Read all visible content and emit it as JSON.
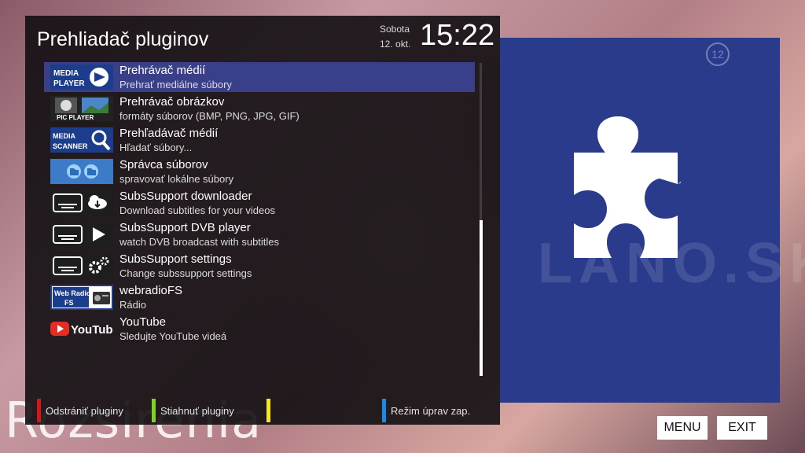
{
  "background": {
    "caption": "Rozsirenia",
    "watermark": "LANO.SK"
  },
  "header": {
    "title": "Prehliadač pluginov",
    "day": "Sobota",
    "date": "12. okt.",
    "time": "15:22"
  },
  "plugins": [
    {
      "title": "Prehrávač médií",
      "subtitle": "Prehrať mediálne súbory",
      "icon": "media-player-icon",
      "icon_text": "MEDIA PLAYER"
    },
    {
      "title": "Prehrávač obrázkov",
      "subtitle": "formáty súborov (BMP, PNG, JPG, GIF)",
      "icon": "pic-player-icon",
      "icon_text": "PIC PLAYER"
    },
    {
      "title": "Prehľadávač médií",
      "subtitle": "Hľadať súbory...",
      "icon": "media-scanner-icon",
      "icon_text": "MEDIA SCANNER"
    },
    {
      "title": "Správca súborov",
      "subtitle": "spravovať lokálne súbory",
      "icon": "file-manager-icon",
      "icon_text": ""
    },
    {
      "title": "SubsSupport downloader",
      "subtitle": "Download subtitles for your videos",
      "icon": "subs-download-icon",
      "icon_text": ""
    },
    {
      "title": "SubsSupport DVB player",
      "subtitle": "watch DVB broadcast with subtitles",
      "icon": "subs-dvb-icon",
      "icon_text": ""
    },
    {
      "title": "SubsSupport settings",
      "subtitle": "Change subssupport settings",
      "icon": "subs-settings-icon",
      "icon_text": ""
    },
    {
      "title": "webradioFS",
      "subtitle": "Rádio",
      "icon": "webradio-icon",
      "icon_text": "Web Radio FS"
    },
    {
      "title": "YouTube",
      "subtitle": "Sledujte YouTube videá",
      "icon": "youtube-icon",
      "icon_text": "YouTube"
    }
  ],
  "selected_index": 0,
  "footer": {
    "red": "Odstrániť pluginy",
    "green": "Stiahnuť pluginy",
    "yellow": "",
    "blue": "Režim úprav zap."
  },
  "colors": {
    "red": "#d01818",
    "green": "#7ed321",
    "yellow": "#f5e61e",
    "blue": "#1e88e5",
    "selection": "#3a3f8a",
    "preview_bg": "#2b3b8c"
  },
  "preview": {
    "badge": "12",
    "icon": "puzzle-icon"
  },
  "keys": {
    "menu": "MENU",
    "exit": "EXIT"
  }
}
